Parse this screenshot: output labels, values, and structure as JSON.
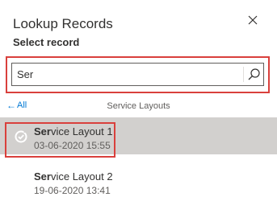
{
  "panel": {
    "title": "Lookup Records",
    "subtitle": "Select record"
  },
  "search": {
    "value": "Ser",
    "placeholder": ""
  },
  "nav": {
    "back_label": "All",
    "section_label": "Service Layouts"
  },
  "records": [
    {
      "match": "Ser",
      "rest": "vice Layout 1",
      "date": "03-06-2020 15:55",
      "selected": true
    },
    {
      "match": "Ser",
      "rest": "vice Layout 2",
      "date": "19-06-2020 13:41",
      "selected": false
    }
  ],
  "icons": {
    "close": "close-icon",
    "search": "search-icon",
    "selected": "check-circle-icon",
    "back": "arrow-left-icon"
  },
  "colors": {
    "accent": "#0078d4",
    "highlight": "#d9403c",
    "selected_row": "#d2d0ce"
  }
}
